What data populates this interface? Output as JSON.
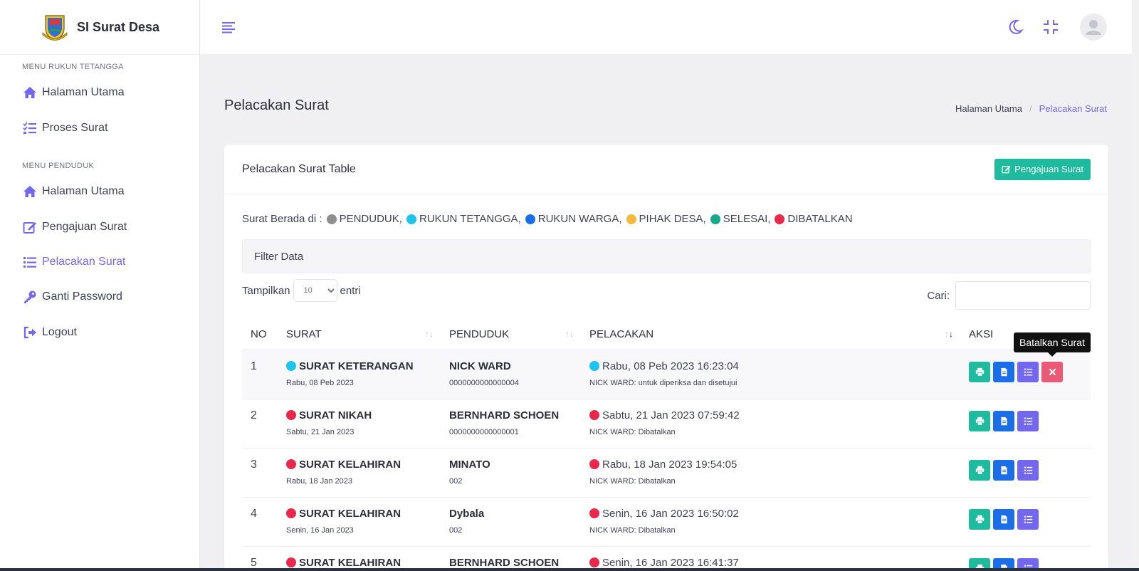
{
  "brand": {
    "name": "SI Surat Desa"
  },
  "sidebar": {
    "sections": [
      {
        "title": "MENU RUKUN TETANGGA",
        "items": [
          {
            "label": "Halaman Utama",
            "icon": "home-icon"
          },
          {
            "label": "Proses Surat",
            "icon": "checklist-icon"
          }
        ]
      },
      {
        "title": "MENU PENDUDUK",
        "items": [
          {
            "label": "Halaman Utama",
            "icon": "home-icon"
          },
          {
            "label": "Pengajuan Surat",
            "icon": "edit-icon"
          },
          {
            "label": "Pelacakan Surat",
            "icon": "list-icon",
            "active": true
          },
          {
            "label": "Ganti Password",
            "icon": "key-icon"
          },
          {
            "label": "Logout",
            "icon": "logout-icon"
          }
        ]
      }
    ]
  },
  "header": {
    "title": "Pelacakan Surat",
    "breadcrumb": [
      "Halaman Utama",
      "Pelacakan Surat"
    ]
  },
  "card": {
    "title": "Pelacakan Surat Table",
    "add_button": "Pengajuan Surat",
    "legend_label": "Surat Berada di :",
    "legend": [
      {
        "label": "PENDUDUK,",
        "color": "#8e8e8e"
      },
      {
        "label": "RUKUN TETANGGA,",
        "color": "#1ec3f0"
      },
      {
        "label": "RUKUN WARGA,",
        "color": "#1a6fe8"
      },
      {
        "label": "PIHAK DESA,",
        "color": "#f6b93b"
      },
      {
        "label": "SELESAI,",
        "color": "#17a98b"
      },
      {
        "label": "DIBATALKAN",
        "color": "#e8294a"
      }
    ],
    "filter_label": "Filter Data",
    "show_label": "Tampilkan",
    "show_value": "10",
    "entries_label": "entri",
    "search_label": "Cari:"
  },
  "table": {
    "columns": [
      "NO",
      "SURAT",
      "PENDUDUK",
      "PELACAKAN",
      "AKSI"
    ],
    "rows": [
      {
        "no": "1",
        "surat": "SURAT KETERANGAN",
        "surat_date": "Rabu, 08 Peb 2023",
        "penduduk": "NICK WARD",
        "nik": "0000000000000004",
        "pelacakan": "Rabu, 08 Peb 2023 16:23:04",
        "note": "NICK WARD: untuk diperiksa dan disetujui",
        "color": "#1ec3f0",
        "cancel": true
      },
      {
        "no": "2",
        "surat": "SURAT NIKAH",
        "surat_date": "Sabtu, 21 Jan 2023",
        "penduduk": "BERNHARD SCHOEN",
        "nik": "0000000000000001",
        "pelacakan": "Sabtu, 21 Jan 2023 07:59:42",
        "note": "NICK WARD: Dibatalkan",
        "color": "#e8294a",
        "cancel": false
      },
      {
        "no": "3",
        "surat": "SURAT KELAHIRAN",
        "surat_date": "Rabu, 18 Jan 2023",
        "penduduk": "MINATO",
        "nik": "002",
        "pelacakan": "Rabu, 18 Jan 2023 19:54:05",
        "note": "NICK WARD: Dibatalkan",
        "color": "#e8294a",
        "cancel": false
      },
      {
        "no": "4",
        "surat": "SURAT KELAHIRAN",
        "surat_date": "Senin, 16 Jan 2023",
        "penduduk": "Dybala",
        "nik": "002",
        "pelacakan": "Senin, 16 Jan 2023 16:50:02",
        "note": "NICK WARD: Dibatalkan",
        "color": "#e8294a",
        "cancel": false
      },
      {
        "no": "5",
        "surat": "SURAT KELAHIRAN",
        "surat_date": "",
        "penduduk": "BERNHARD SCHOEN",
        "nik": "",
        "pelacakan": "Senin, 16 Jan 2023 16:41:37",
        "note": "",
        "color": "#e8294a",
        "cancel": false
      }
    ]
  },
  "tooltip": "Batalkan Surat"
}
